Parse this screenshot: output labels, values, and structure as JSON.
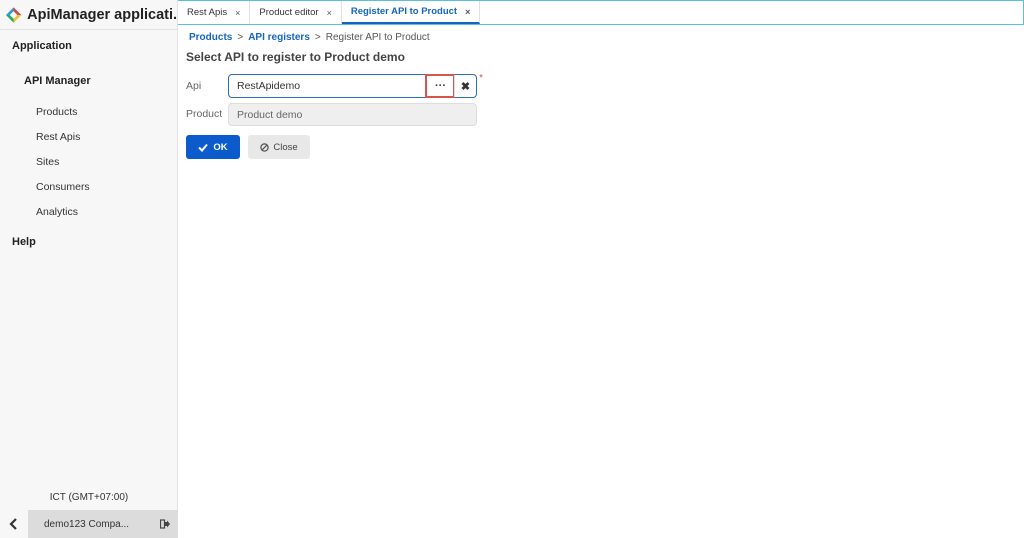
{
  "app": {
    "title": "ApiManager applicati...",
    "logo_icon": "diamond-logo-icon",
    "brand_colors": [
      "#e0453a",
      "#2d9cdb",
      "#f2c230",
      "#27ae60"
    ]
  },
  "sidebar": {
    "sections": [
      {
        "label": "Application"
      },
      {
        "label": "Help"
      }
    ],
    "group": {
      "label": "API Manager"
    },
    "items": [
      {
        "label": "Products"
      },
      {
        "label": "Rest Apis"
      },
      {
        "label": "Sites"
      },
      {
        "label": "Consumers"
      },
      {
        "label": "Analytics"
      }
    ],
    "timezone": "ICT (GMT+07:00)",
    "user": "demo123 Compa...",
    "collapse_icon": "chevron-left-icon",
    "logout_icon": "sign-out-icon"
  },
  "tabs": [
    {
      "label": "Rest Apis",
      "close": "×",
      "active": false
    },
    {
      "label": "Product editor",
      "close": "×",
      "active": false
    },
    {
      "label": "Register API to Product",
      "close": "×",
      "active": true
    }
  ],
  "breadcrumb": {
    "items": [
      "Products",
      "API registers",
      "Register API to Product"
    ],
    "separator": ">"
  },
  "page": {
    "title": "Select API to register to Product demo"
  },
  "form": {
    "api": {
      "label": "Api",
      "value": "RestApidemo",
      "lookup_button": "···",
      "clear_button": "✖",
      "required_mark": "*"
    },
    "product": {
      "label": "Product",
      "value": "Product demo"
    }
  },
  "buttons": {
    "ok": {
      "label": "OK",
      "icon": "check-icon"
    },
    "close": {
      "label": "Close",
      "icon": "ban-icon"
    }
  },
  "colors": {
    "primary": "#0b5bcc",
    "link": "#1565c0",
    "tab_border": "#5bc0de",
    "highlight": "#d9534f"
  }
}
